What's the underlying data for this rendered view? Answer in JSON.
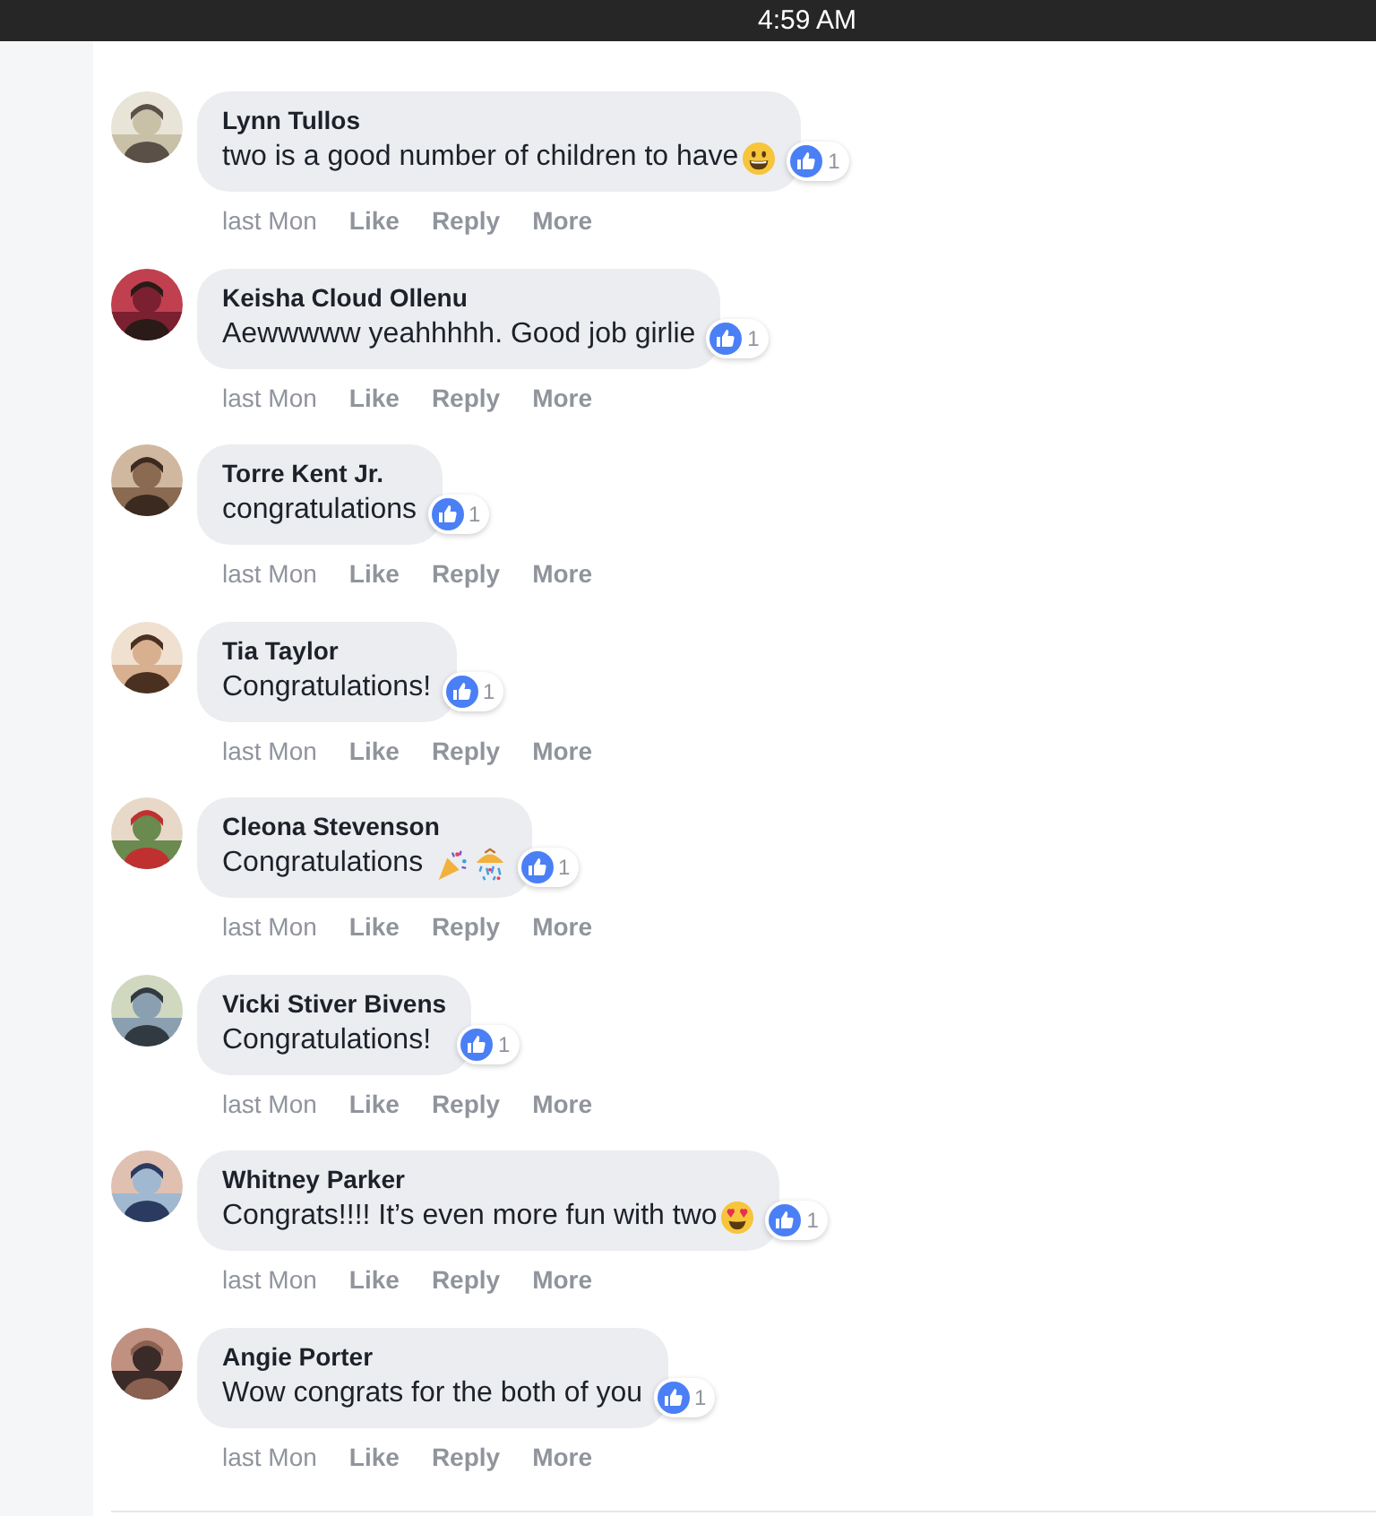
{
  "status_bar": {
    "time": "4:59 AM"
  },
  "comments": [
    {
      "author": "Lynn Tullos",
      "text": "two is a good number of children to have",
      "emojis": [
        {
          "kind": "grin"
        }
      ],
      "likes": "1",
      "time": "last Mon",
      "actions": [
        "Like",
        "Reply",
        "More"
      ]
    },
    {
      "author": "Keisha Cloud Ollenu",
      "text": "Aewwwww yeahhhhh. Good job girlie",
      "likes": "1",
      "time": "last Mon",
      "actions": [
        "Like",
        "Reply",
        "More"
      ]
    },
    {
      "author": "Torre Kent Jr.",
      "text": "congratulations",
      "likes": "1",
      "time": "last Mon",
      "actions": [
        "Like",
        "Reply",
        "More"
      ]
    },
    {
      "author": "Tia Taylor",
      "text": "Congratulations!",
      "likes": "1",
      "time": "last Mon",
      "actions": [
        "Like",
        "Reply",
        "More"
      ]
    },
    {
      "author": "Cleona Stevenson",
      "text": "Congratulations ",
      "emojis": [
        {
          "kind": "popper"
        },
        {
          "kind": "confetti"
        }
      ],
      "likes": "1",
      "time": "last Mon",
      "actions": [
        "Like",
        "Reply",
        "More"
      ]
    },
    {
      "author": "Vicki Stiver Bivens",
      "text": "Congratulations!",
      "likes": "1",
      "time": "last Mon",
      "actions": [
        "Like",
        "Reply",
        "More"
      ]
    },
    {
      "author": "Whitney Parker",
      "text": "Congrats!!!! It’s even more fun with two",
      "emojis": [
        {
          "kind": "heart-eyes"
        }
      ],
      "likes": "1",
      "time": "last Mon",
      "actions": [
        "Like",
        "Reply",
        "More"
      ]
    },
    {
      "author": "Angie Porter",
      "text": "Wow congrats for the both of you",
      "likes": "1",
      "time": "last Mon",
      "actions": [
        "Like",
        "Reply",
        "More"
      ]
    }
  ]
}
